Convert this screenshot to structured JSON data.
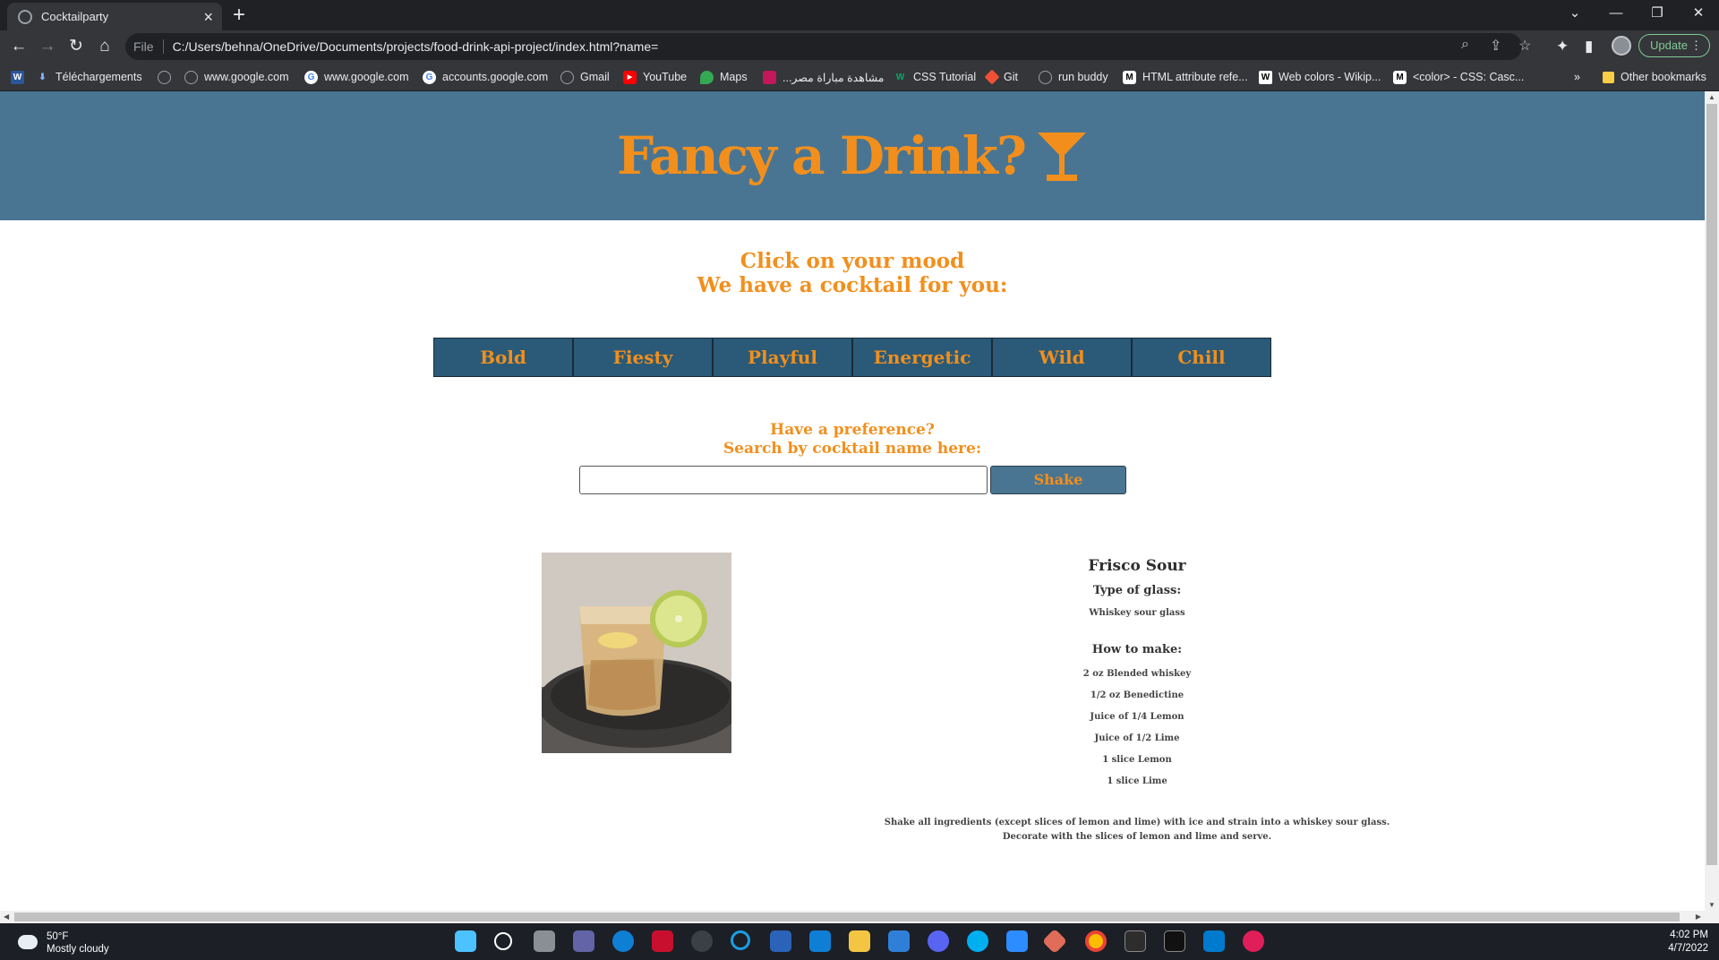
{
  "browser": {
    "tab_title": "Cocktailparty",
    "url_scheme": "File",
    "url": "C:/Users/behna/OneDrive/Documents/projects/food-drink-api-project/index.html?name=",
    "update_label": "Update",
    "bookmarks": [
      {
        "label": "Téléchargements",
        "icon": "download-icon"
      },
      {
        "label": "",
        "icon": "globe-icon"
      },
      {
        "label": "www.google.com",
        "icon": "globe-icon"
      },
      {
        "label": "www.google.com",
        "icon": "google-icon"
      },
      {
        "label": "accounts.google.com",
        "icon": "google-icon"
      },
      {
        "label": "Gmail",
        "icon": "globe-icon"
      },
      {
        "label": "YouTube",
        "icon": "youtube-icon"
      },
      {
        "label": "Maps",
        "icon": "maps-icon"
      },
      {
        "label": "...مشاهدة مباراة مصر",
        "icon": "site-icon"
      },
      {
        "label": "CSS Tutorial",
        "icon": "w3-icon"
      },
      {
        "label": "Git",
        "icon": "git-icon"
      },
      {
        "label": "run buddy",
        "icon": "globe-icon"
      },
      {
        "label": "HTML attribute refe...",
        "icon": "mdn-icon"
      },
      {
        "label": "Web colors - Wikip...",
        "icon": "wikipedia-icon"
      },
      {
        "label": "<color> - CSS: Casc...",
        "icon": "mdn-icon"
      }
    ],
    "other_bookmarks": "Other bookmarks",
    "more": "»"
  },
  "page": {
    "title": "Fancy a Drink?",
    "mood_prompt_1": "Click on your mood",
    "mood_prompt_2": "We have a cocktail for you:",
    "moods": [
      "Bold",
      "Fiesty",
      "Playful",
      "Energetic",
      "Wild",
      "Chill"
    ],
    "pref_1": "Have a preference?",
    "pref_2": "Search by cocktail name here:",
    "search_value": "",
    "shake_label": "Shake",
    "cocktail": {
      "name": "Frisco Sour",
      "glass_label": "Type of glass:",
      "glass": "Whiskey sour glass",
      "how_label": "How to make:",
      "ingredients": [
        "2 oz Blended whiskey",
        "1/2 oz Benedictine",
        "Juice of 1/4 Lemon",
        "Juice of 1/2 Lime",
        "1 slice Lemon",
        "1 slice Lime"
      ],
      "instructions": "Shake all ingredients (except slices of lemon and lime) with ice and strain into a whiskey sour glass. Decorate with the slices of lemon and lime and serve."
    }
  },
  "colors": {
    "header_bg": "#4a7592",
    "accent": "#f28f1c",
    "mood_btn_bg": "#2a5a78"
  },
  "taskbar": {
    "temp": "50°F",
    "weather": "Mostly cloudy",
    "time": "4:02 PM",
    "date": "4/7/2022"
  }
}
